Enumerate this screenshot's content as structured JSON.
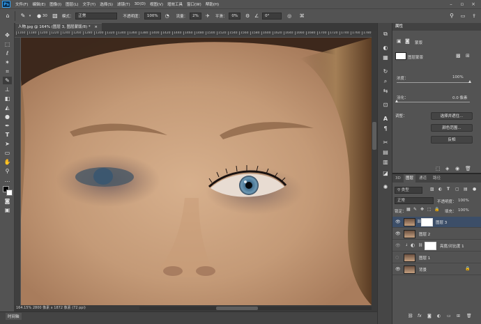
{
  "menubar": {
    "logo": "Ps",
    "items": [
      "文件(F)",
      "编辑(E)",
      "图像(I)",
      "图层(L)",
      "文字(Y)",
      "选择(S)",
      "滤镜(T)",
      "3D(D)",
      "视图(V)",
      "增效工具",
      "窗口(W)",
      "帮助(H)"
    ]
  },
  "options": {
    "brush_size": "30",
    "mode_label": "模式：",
    "mode_value": "正常",
    "opacity_label": "不透明度：",
    "opacity_value": "100%",
    "flow_label": "流量：",
    "flow_value": "2%",
    "smooth_label": "平滑：",
    "smooth_value": "0%",
    "angle_value": "0°"
  },
  "document": {
    "tab_title": "人物.jpg @ 164% (图层 3, 图层蒙版/8) *",
    "ruler_ticks": [
      "1160",
      "1180",
      "1200",
      "1220",
      "1240",
      "1260",
      "1280",
      "1300",
      "1320",
      "1340",
      "1360",
      "1380",
      "1400",
      "1420",
      "1440",
      "1460",
      "1480",
      "1500",
      "1520",
      "1540",
      "1560",
      "1580",
      "1600",
      "1620",
      "1640",
      "1660",
      "1680",
      "1700",
      "1720",
      "1740",
      "1760",
      "1780"
    ],
    "status": "164.15%   2800 像素 x 1872 像素 (72 ppi)",
    "timeline": "时间轴"
  },
  "properties": {
    "title": "属性",
    "mask_label": "蒙版",
    "layer_mask_label": "图层蒙版",
    "density_label": "浓度：",
    "density_value": "100%",
    "feather_label": "羽化：",
    "feather_value": "0.0 像素",
    "adjust_label": "调整：",
    "select_mask_btn": "选择并遮住...",
    "color_range_btn": "颜色范围...",
    "invert_btn": "反相"
  },
  "layers_panel": {
    "tabs": [
      "3D",
      "图层",
      "通道",
      "路径"
    ],
    "filter_label": "类型",
    "blend_mode": "正常",
    "opacity_label": "不透明度：",
    "opacity_value": "100%",
    "lock_label": "锁定：",
    "fill_label": "填充：",
    "fill_value": "100%",
    "layers": [
      {
        "name": "图层 3"
      },
      {
        "name": "图层 2"
      },
      {
        "name": "亮度/对比度 1"
      },
      {
        "name": "图层 1"
      },
      {
        "name": "背景"
      }
    ]
  }
}
